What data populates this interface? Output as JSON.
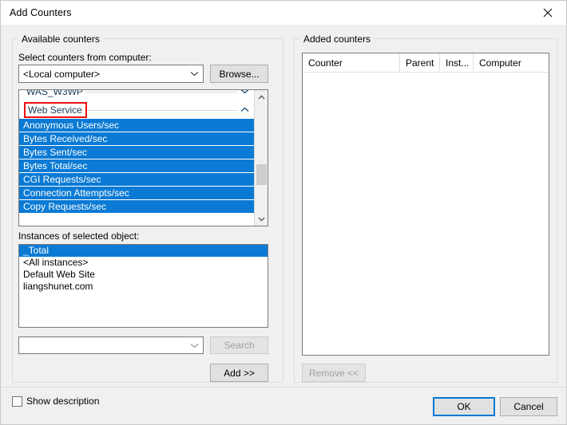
{
  "window": {
    "title": "Add Counters",
    "close_icon": "close-icon"
  },
  "available_counters": {
    "group_label": "Available counters",
    "select_computer_label": "Select counters from computer:",
    "computer_combo": {
      "value": "<Local computer>",
      "arrow_icon": "chevron-down-icon"
    },
    "browse_button": "Browse...",
    "counter_tree": {
      "groups": [
        {
          "name": "WAS_W3WP",
          "expanded": false,
          "highlighted": false,
          "chevron_icon": "chevron-down-icon"
        },
        {
          "name": "Web Service",
          "expanded": true,
          "highlighted": true,
          "chevron_icon": "chevron-up-icon"
        }
      ],
      "items": [
        "Anonymous Users/sec",
        "Bytes Received/sec",
        "Bytes Sent/sec",
        "Bytes Total/sec",
        "CGI Requests/sec",
        "Connection Attempts/sec",
        "Copy Requests/sec"
      ],
      "scrollbar": {
        "up_icon": "chevron-up-icon",
        "down_icon": "chevron-down-icon"
      }
    },
    "instances_label": "Instances of selected object:",
    "instances": [
      {
        "label": "_Total",
        "selected": true
      },
      {
        "label": "<All instances>",
        "selected": false
      },
      {
        "label": "Default Web Site",
        "selected": false
      },
      {
        "label": "liangshunet.com",
        "selected": false
      }
    ],
    "search_combo": {
      "value": "",
      "placeholder": "",
      "arrow_icon": "chevron-down-icon"
    },
    "search_button": {
      "label": "Search",
      "disabled": true
    },
    "add_button": {
      "label": "Add >>",
      "disabled": false
    }
  },
  "added_counters": {
    "group_label": "Added counters",
    "columns": [
      "Counter",
      "Parent",
      "Inst...",
      "Computer"
    ],
    "rows": [],
    "remove_button": {
      "label": "Remove <<",
      "disabled": true
    }
  },
  "footer": {
    "show_description_label": "Show description",
    "show_description_checked": false,
    "ok_button": "OK",
    "cancel_button": "Cancel"
  },
  "colors": {
    "accent": "#0078d7",
    "selection": "#0a7ad4",
    "highlight_box": "#ee1111",
    "dialog_bg": "#f0f0f0"
  }
}
